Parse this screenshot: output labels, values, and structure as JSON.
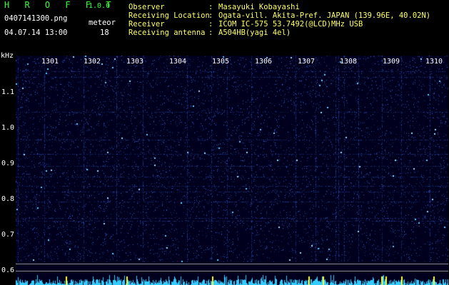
{
  "header": {
    "app_title": "H R O F F T",
    "app_version": "1.0.0",
    "filename": "0407141300.png",
    "meteor_label": "meteor",
    "datetime": "04.07.14 13:00",
    "meteor_count": "18"
  },
  "info": [
    {
      "label": "Observer",
      "colon": ":",
      "value": "Masayuki Kobayashi"
    },
    {
      "label": "Receiving Location",
      "colon": ":",
      "value": "Ogata-vill. Akita-Pref. JAPAN (139.96E, 40.02N)"
    },
    {
      "label": "Receiver",
      "colon": ":",
      "value": "ICOM IC-575 53.7492(@LCD)MHz USB"
    },
    {
      "label": "Receiving antenna",
      "colon": ":",
      "value": "A504HB(yagi 4el)"
    }
  ],
  "axes": {
    "unit": "kHz",
    "time_labels": [
      "1301",
      "1302",
      "1303",
      "1304",
      "1305",
      "1306",
      "1307",
      "1308",
      "1309",
      "1310"
    ],
    "freq_labels": [
      "1.1",
      "1.0",
      "0.9",
      "0.8",
      "0.7",
      "0.6"
    ]
  },
  "colors": {
    "background": "#000000",
    "title_green": "#33ff33",
    "info_yellow": "#ffff66",
    "plot_navy": "#000022",
    "signal_blue": "#3366ff",
    "signal_cyan": "#66ccff",
    "spectrum_cyan": "#33ccff",
    "marker_yellow": "#ffff33"
  }
}
